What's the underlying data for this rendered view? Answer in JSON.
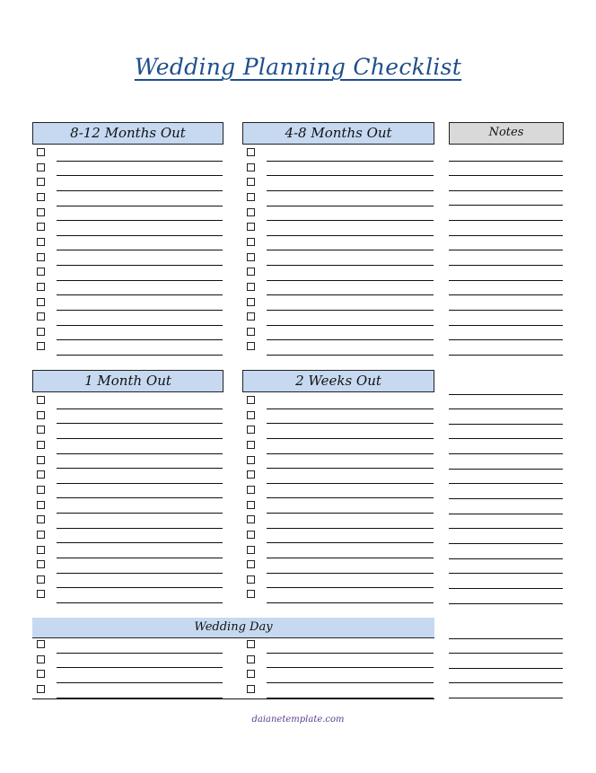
{
  "title": "Wedding Planning Checklist",
  "sections": [
    {
      "label": "8-12 Months Out",
      "rows": 14
    },
    {
      "label": "4-8 Months Out",
      "rows": 14
    },
    {
      "label": "1 Month Out",
      "rows": 14
    },
    {
      "label": "2 Weeks Out",
      "rows": 14
    },
    {
      "label": "Wedding Day",
      "rows": 4
    }
  ],
  "notes": {
    "label": "Notes"
  },
  "colors": {
    "title": "#1f4e8c",
    "header_fill": "#c6d9f1",
    "notes_fill": "#d9d9d9",
    "footer": "#5c3f8f"
  },
  "footer": "daianetemplate.com"
}
